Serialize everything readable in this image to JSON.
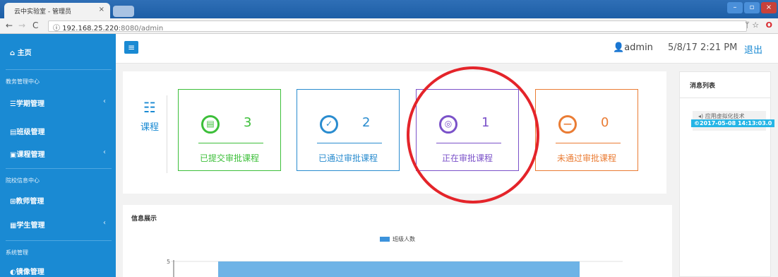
{
  "browser": {
    "tab_title": "云中实验室 - 管理员",
    "tab_close": "×",
    "url_host": "192.168.25.220",
    "url_rest": ":8080/admin"
  },
  "sidebar": {
    "home": "主页",
    "sections": [
      {
        "title": "教务管理中心"
      },
      {
        "title": "院校信息中心"
      },
      {
        "title": "系统管理"
      }
    ],
    "items": [
      {
        "label": "学期管理",
        "arrow": "‹"
      },
      {
        "label": "班级管理"
      },
      {
        "label": "课程管理",
        "arrow": "‹"
      },
      {
        "label": "教师管理"
      },
      {
        "label": "学生管理",
        "arrow": "‹"
      },
      {
        "label": "镜像管理"
      }
    ]
  },
  "topbar": {
    "user": "admin",
    "datetime": "5/8/17 2:21 PM",
    "logout": "退出"
  },
  "course_panel": {
    "label": "课程",
    "stats": [
      {
        "count": "3",
        "label": "已提交审批课程",
        "color": "#3dbf3a"
      },
      {
        "count": "2",
        "label": "已通过审批课程",
        "color": "#2a8ccf"
      },
      {
        "count": "1",
        "label": "正在审批课程",
        "color": "#7b52c9"
      },
      {
        "count": "0",
        "label": "未通过审批课程",
        "color": "#ea7c34"
      }
    ]
  },
  "info_panel": {
    "title": "信息展示",
    "chart_data": {
      "type": "bar",
      "legend": [
        "班级人数"
      ],
      "yticks": [
        "5"
      ],
      "series": [
        {
          "name": "班级人数",
          "color": "#6eb3e6"
        }
      ]
    }
  },
  "message_panel": {
    "title": "消息列表",
    "items": [
      {
        "text": "应用虚拟化技术",
        "time": "©2017-05-08 14:13:03.0"
      }
    ]
  }
}
